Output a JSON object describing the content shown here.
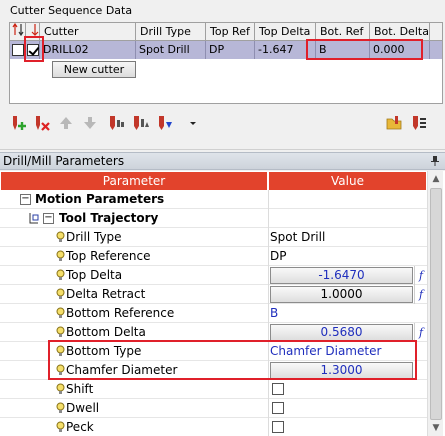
{
  "cutter_sequence": {
    "title": "Cutter Sequence Data",
    "columns": [
      "",
      "",
      "Cutter",
      "Drill Type",
      "Top Ref",
      "Top Delta",
      "Bot. Ref",
      "Bot. Delta"
    ],
    "rows": [
      {
        "cutter": "DRILL02",
        "drill_type": "Spot Drill",
        "top_ref": "DP",
        "top_delta": "-1.647",
        "bot_ref": "B",
        "bot_delta": "0.000",
        "checked": true
      }
    ],
    "new_cutter_label": "New cutter"
  },
  "toolbar": {
    "icons": [
      "add-cutter-icon",
      "delete-cutter-icon",
      "move-up-icon",
      "move-down-icon",
      "cutter-tool-icon",
      "cutter-tool-2-icon",
      "cutter-tool-3-icon",
      "binoculars-icon",
      "dropdown-arrow-icon",
      "open-folder-icon",
      "cutter-list-icon"
    ]
  },
  "params": {
    "title": "Drill/Mill Parameters",
    "col_parameter": "Parameter",
    "col_value": "Value",
    "sections": {
      "motion": "Motion Parameters",
      "trajectory": "Tool Trajectory"
    },
    "rows": [
      {
        "name": "Drill Type",
        "value": "Spot Drill"
      },
      {
        "name": "Top Reference",
        "value": "DP"
      },
      {
        "name": "Top Delta",
        "value": "-1.6470"
      },
      {
        "name": "Delta Retract",
        "value": "1.0000"
      },
      {
        "name": "Bottom Reference",
        "value": "B"
      },
      {
        "name": "Bottom Delta",
        "value": "0.5680"
      },
      {
        "name": "Bottom Type",
        "value": "Chamfer Diameter"
      },
      {
        "name": "Chamfer Diameter",
        "value": "1.3000"
      },
      {
        "name": "Shift",
        "value": ""
      },
      {
        "name": "Dwell",
        "value": ""
      },
      {
        "name": "Peck",
        "value": ""
      }
    ],
    "formula_symbol": "f"
  },
  "colors": {
    "header_accent": "#e2432c",
    "highlight": "#e0202a",
    "selection": "#b7b7d7",
    "value_blue": "#1f2ebd"
  }
}
